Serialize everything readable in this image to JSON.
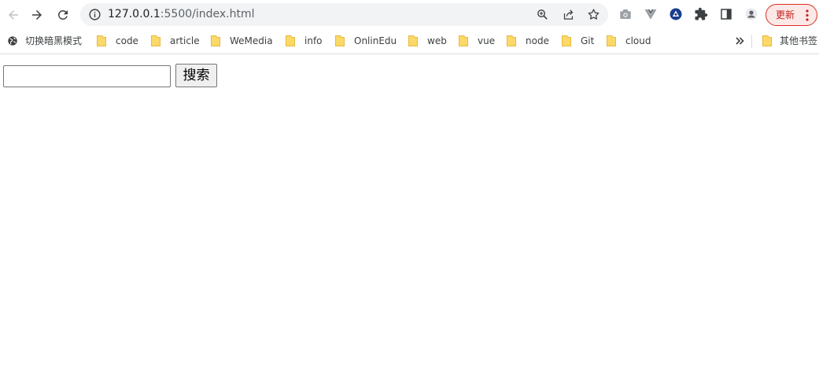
{
  "browser": {
    "url_host": "127.0.0.1",
    "url_rest": ":5500/index.html",
    "update_label": "更新"
  },
  "toolbar_icons": [
    "back-arrow-icon",
    "forward-arrow-icon",
    "reload-icon",
    "info-icon",
    "zoom-icon",
    "share-icon",
    "star-icon",
    "camera-icon",
    "vue-devtools-icon",
    "circle-extension-icon",
    "puzzle-icon",
    "side-panel-icon",
    "avatar-icon",
    "more-vert-icon"
  ],
  "bookmarks": {
    "dark_mode": "切换暗黑模式",
    "folders": [
      "code",
      "article",
      "WeMedia",
      "info",
      "OnlinEdu",
      "web",
      "vue",
      "node",
      "Git",
      "cloud"
    ],
    "others": "其他书签"
  },
  "page": {
    "search_value": "",
    "search_button": "搜索"
  },
  "colors": {
    "folder": "#fbd968",
    "update_border": "#d93025",
    "update_bg": "#fce8e6",
    "omnibox_bg": "#f1f3f4"
  }
}
